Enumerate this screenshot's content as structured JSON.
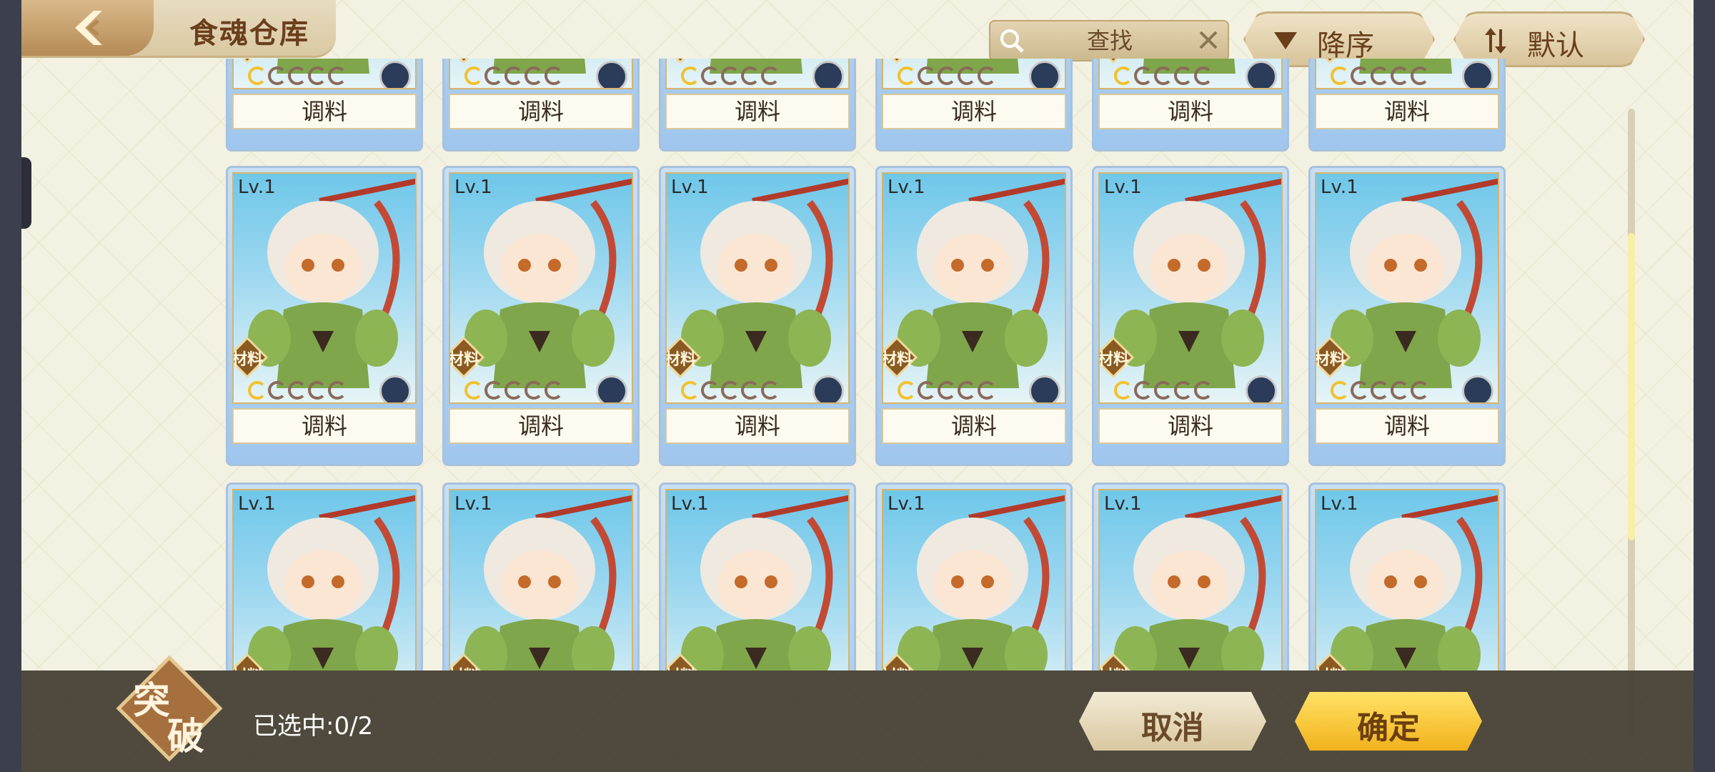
{
  "header": {
    "title": "食魂仓库",
    "search_placeholder": "查找",
    "sort_label": "降序",
    "default_label": "默认"
  },
  "cards_top": [
    {
      "name": "调料"
    },
    {
      "name": "调料"
    },
    {
      "name": "调料"
    },
    {
      "name": "调料"
    },
    {
      "name": "调料"
    },
    {
      "name": "调料"
    }
  ],
  "cards_mid": [
    {
      "level": "Lv.1",
      "tag": "材料",
      "name": "调料"
    },
    {
      "level": "Lv.1",
      "tag": "材料",
      "name": "调料"
    },
    {
      "level": "Lv.1",
      "tag": "材料",
      "name": "调料"
    },
    {
      "level": "Lv.1",
      "tag": "材料",
      "name": "调料"
    },
    {
      "level": "Lv.1",
      "tag": "材料",
      "name": "调料"
    },
    {
      "level": "Lv.1",
      "tag": "材料",
      "name": "调料"
    }
  ],
  "cards_bot": [
    {
      "level": "Lv.1",
      "tag": "材料"
    },
    {
      "level": "Lv.1",
      "tag": "材料"
    },
    {
      "level": "Lv.1",
      "tag": "材料"
    },
    {
      "level": "Lv.1",
      "tag": "材料"
    },
    {
      "level": "Lv.1",
      "tag": "材料"
    },
    {
      "level": "Lv.1",
      "tag": "材料"
    }
  ],
  "footer": {
    "mode_char1": "突",
    "mode_char2": "破",
    "selected": "已选中:0/2",
    "cancel_label": "取消",
    "confirm_label": "确定"
  },
  "colors": {
    "accent_gold": "#f2b21c",
    "brown_text": "#6b3f1c",
    "card_blue": "#9fc6ee"
  }
}
